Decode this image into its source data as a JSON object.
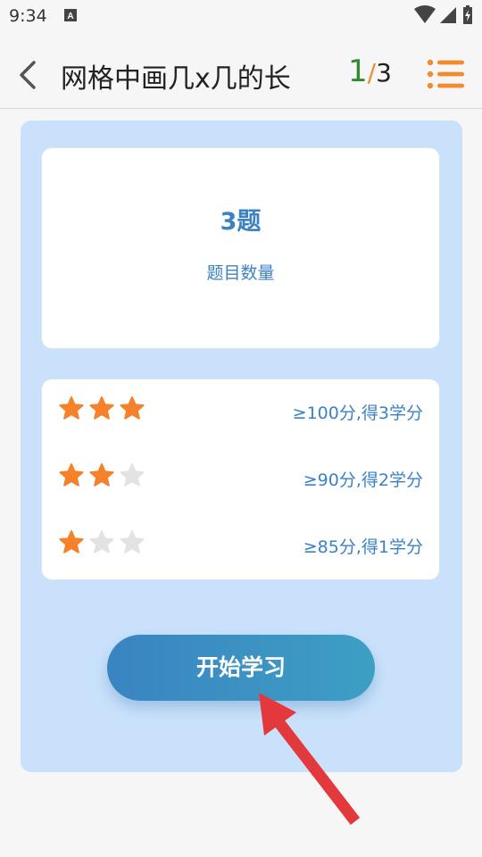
{
  "status_bar": {
    "time": "9:34",
    "notification_icon": "a-notification-icon",
    "icons": [
      "wifi-icon",
      "signal-icon",
      "battery-charging-icon"
    ]
  },
  "header": {
    "title": "网格中画几x几的长",
    "progress": {
      "current": "1",
      "separator": "/",
      "total": "3"
    }
  },
  "summary": {
    "count": "3题",
    "count_label": "题目数量"
  },
  "rules": [
    {
      "stars_filled": 3,
      "stars_total": 3,
      "text": "≥100分,得3学分"
    },
    {
      "stars_filled": 2,
      "stars_total": 3,
      "text": "≥90分,得2学分"
    },
    {
      "stars_filled": 1,
      "stars_total": 3,
      "text": "≥85分,得1学分"
    }
  ],
  "start_button": {
    "label": "开始学习"
  },
  "colors": {
    "accent_blue": "#3b82c4",
    "star_filled": "#f5822a",
    "star_empty": "#e3e3e3",
    "arrow_red": "#e3393c",
    "panel_bg": "#c9e1fb"
  }
}
